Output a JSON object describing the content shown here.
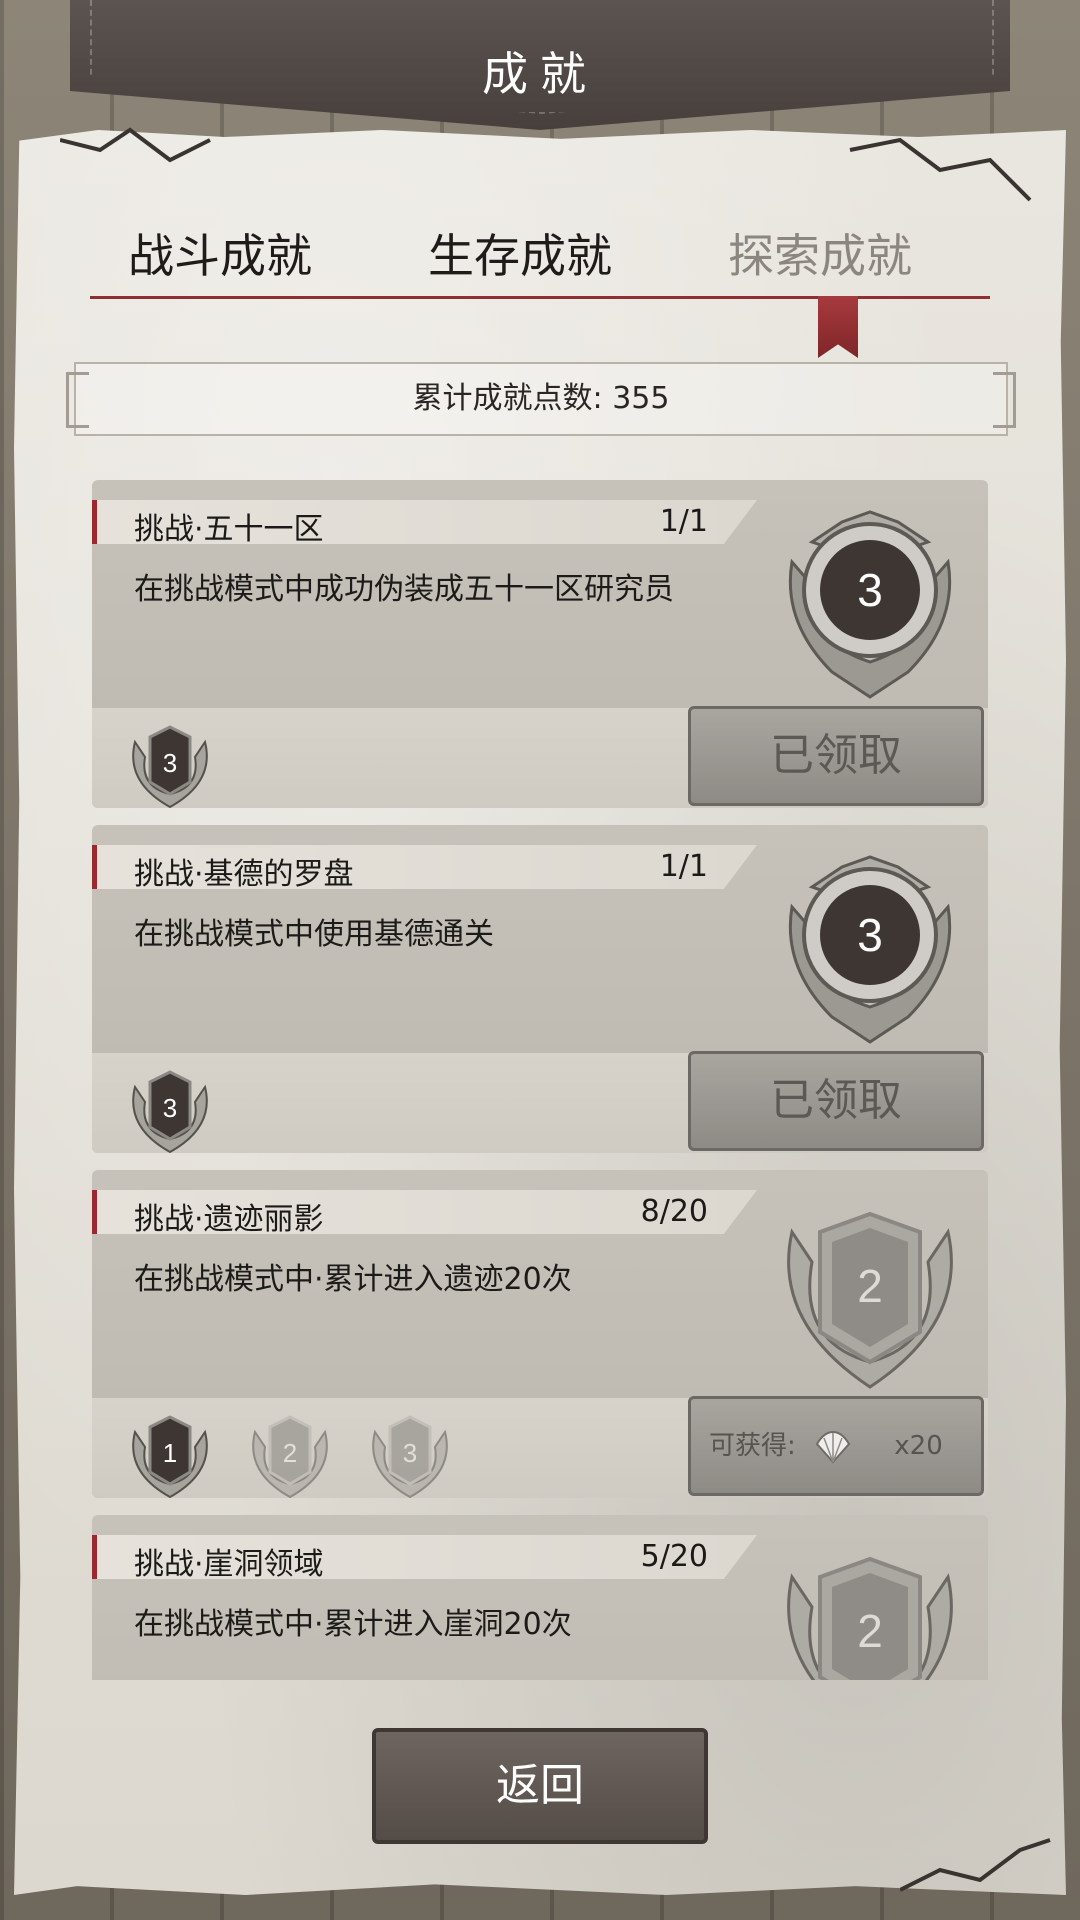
{
  "header": {
    "title": "成就"
  },
  "tabs": [
    {
      "label": "战斗成就",
      "active": true
    },
    {
      "label": "生存成就",
      "active": true
    },
    {
      "label": "探索成就",
      "active": false
    }
  ],
  "points": {
    "text": "累计成就点数: 355"
  },
  "cards": [
    {
      "title": "挑战·五十一区",
      "progress": "1/1",
      "description": "在挑战模式中成功伪装成五十一区研究员",
      "badge_value": "3",
      "tier_medals": [
        "3"
      ],
      "action": {
        "type": "claimed",
        "label": "已领取"
      }
    },
    {
      "title": "挑战·基德的罗盘",
      "progress": "1/1",
      "description": "在挑战模式中使用基德通关",
      "badge_value": "3",
      "tier_medals": [
        "3"
      ],
      "action": {
        "type": "claimed",
        "label": "已领取"
      }
    },
    {
      "title": "挑战·遗迹丽影",
      "progress": "8/20",
      "description": "在挑战模式中·累计进入遗迹20次",
      "badge_value": "2",
      "tier_medals": [
        "1",
        "2",
        "3"
      ],
      "action": {
        "type": "reward",
        "label": "可获得:",
        "icon": "shell-icon",
        "amount": "x20"
      }
    },
    {
      "title": "挑战·崖洞领域",
      "progress": "5/20",
      "description": "在挑战模式中·累计进入崖洞20次",
      "badge_value": "2",
      "tier_medals": [],
      "action": null
    }
  ],
  "footer": {
    "back_label": "返回"
  },
  "colors": {
    "accent_red": "#8d2f33",
    "badge_dark": "#3e3633",
    "paper": "#e3e0d8"
  }
}
